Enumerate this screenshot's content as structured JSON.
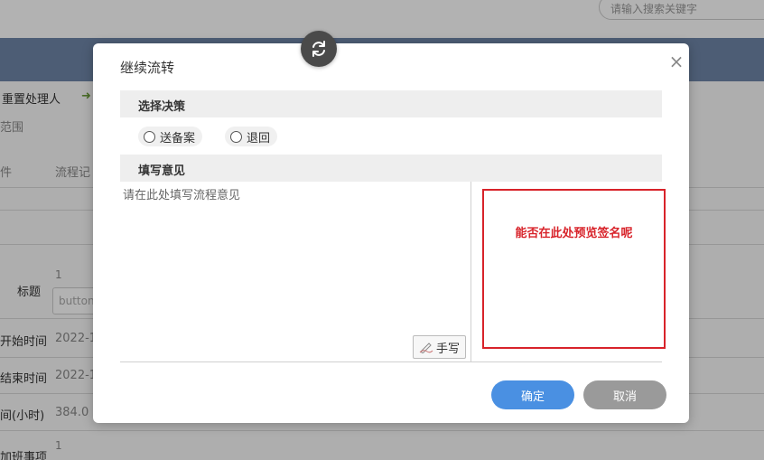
{
  "header": {
    "search_placeholder": "请输入搜索关键字"
  },
  "background": {
    "reset_handler": "重置处理人",
    "scope": "范围",
    "tab_file": "件",
    "tab_flow_record": "流程记",
    "row1_value": "1",
    "label_title": "标题",
    "title_field_value": "button",
    "label_start": "开始时间",
    "start_value": "2022-1",
    "label_end": "结束时间",
    "end_value": "2022-1",
    "label_hours": "间(小时)",
    "hours_value": "384.0",
    "row_last_value": "1",
    "label_overtime": "加班事项"
  },
  "dialog": {
    "title": "继续流转",
    "close_icon": "close-icon",
    "refresh_icon": "refresh-icon",
    "decision_section": "选择决策",
    "options": [
      {
        "label": "送备案"
      },
      {
        "label": "退回"
      }
    ],
    "opinion_section": "填写意见",
    "opinion_placeholder": "请在此处填写流程意见",
    "handwrite_label": "手写",
    "signature_hint": "能否在此处预览签名呢",
    "confirm_label": "确定",
    "cancel_label": "取消"
  },
  "colors": {
    "band": "#6f86a8",
    "confirm": "#4a90e2",
    "cancel": "#9a9a9a",
    "signature_border": "#d8232a"
  }
}
